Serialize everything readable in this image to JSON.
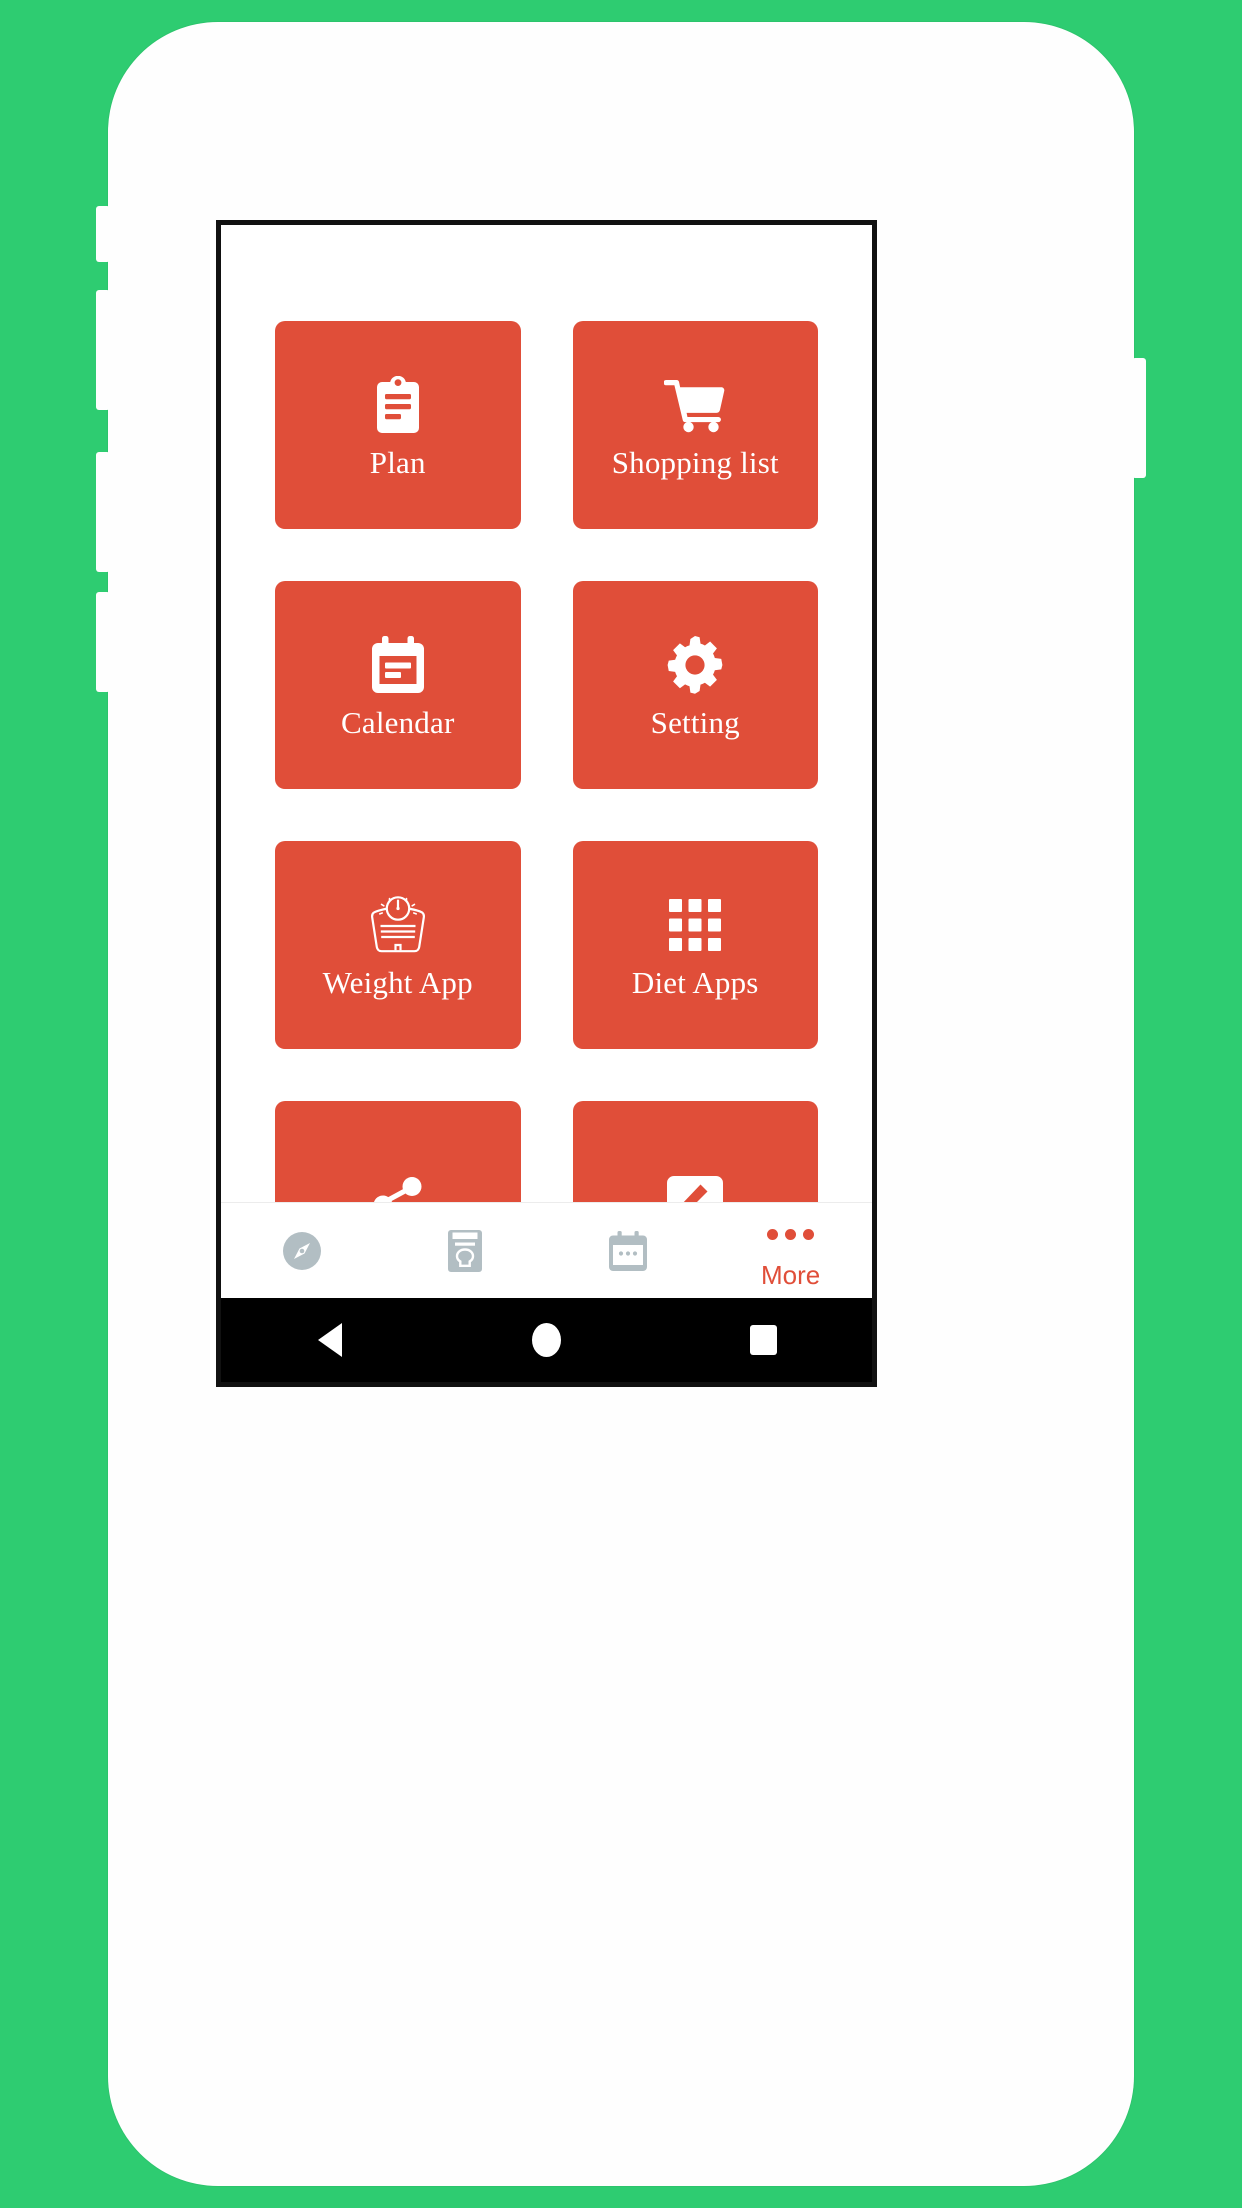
{
  "theme": {
    "background_green": "#2ECC71",
    "phone_body": "#FFFFFF",
    "tile_red": "#E04E39",
    "accent_red": "#E04E39",
    "tab_inactive_gray": "#B2BEC3",
    "screen_bezel": "#111111",
    "system_nav_bg": "#000000"
  },
  "app": {
    "tiles": [
      {
        "label": "Plan",
        "icon": "clipboard-icon",
        "has_label": true
      },
      {
        "label": "Shopping list",
        "icon": "shopping-cart-icon",
        "has_label": true
      },
      {
        "label": "Calendar",
        "icon": "calendar-icon",
        "has_label": true
      },
      {
        "label": "Setting",
        "icon": "gear-icon",
        "has_label": true
      },
      {
        "label": "Weight App",
        "icon": "weight-scale-icon",
        "has_label": true
      },
      {
        "label": "Diet Apps",
        "icon": "apps-grid-icon",
        "has_label": true
      },
      {
        "label": "",
        "icon": "share-icon",
        "has_label": false
      },
      {
        "label": "",
        "icon": "feedback-pencil-icon",
        "has_label": false
      }
    ]
  },
  "tab_bar": {
    "items": [
      {
        "label": "",
        "icon": "compass-icon",
        "active": false
      },
      {
        "label": "",
        "icon": "cookbook-icon",
        "active": false
      },
      {
        "label": "",
        "icon": "calendar-icon",
        "active": false
      },
      {
        "label": "More",
        "icon": "more-dots-icon",
        "active": true
      }
    ]
  },
  "system_nav": {
    "back_label": "Back",
    "home_label": "Home",
    "recents_label": "Recents"
  }
}
